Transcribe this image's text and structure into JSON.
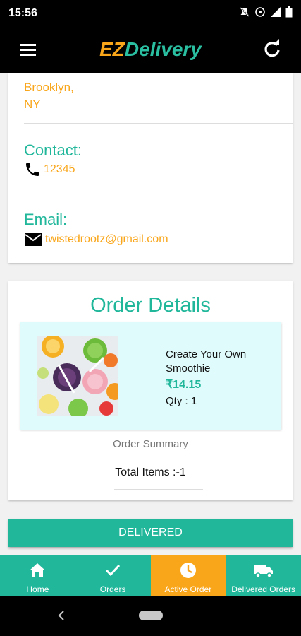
{
  "status_bar": {
    "time": "15:56"
  },
  "app_bar": {
    "logo_part1": "EZ",
    "logo_part2": "Delivery"
  },
  "info_card": {
    "address_line1": "Brooklyn,",
    "address_line2": "NY",
    "contact_title": "Contact:",
    "contact_value": "12345",
    "email_title": "Email:",
    "email_value": "twistedrootz@gmail.com"
  },
  "order": {
    "title": "Order Details",
    "item": {
      "name": "Create Your Own Smoothie",
      "price": "₹14.15",
      "qty": "Qty : 1"
    },
    "summary_label": "Order Summary",
    "total_items": "Total Items :-1"
  },
  "action_button": "DELIVERED",
  "bottom_nav": [
    {
      "label": "Home",
      "icon": "home-icon"
    },
    {
      "label": "Orders",
      "icon": "check-icon"
    },
    {
      "label": "Active Order",
      "icon": "clock-icon",
      "active": true
    },
    {
      "label": "Delivered Orders",
      "icon": "truck-icon"
    }
  ],
  "colors": {
    "accent": "#21b79b",
    "orange": "#f9a61a",
    "item_bg": "#e0fbfc"
  }
}
